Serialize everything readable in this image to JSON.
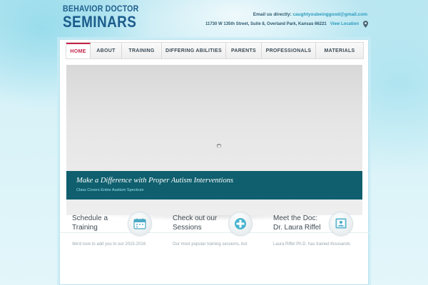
{
  "brand": {
    "line1": "BEHAVIOR DOCTOR",
    "line2": "SEMINARS"
  },
  "contact": {
    "email_label": "Email us directly:",
    "email": "caughtyoubeinggood@gmail.com",
    "address": "11730 W 135th Street, Suite 8, Overland Park, Kansas 66221",
    "view_location": "View Location"
  },
  "nav": {
    "items": [
      {
        "label": "HOME",
        "active": true
      },
      {
        "label": "ABOUT",
        "active": false
      },
      {
        "label": "TRAINING",
        "active": false
      },
      {
        "label": "DIFFERING ABILITIES",
        "active": false
      },
      {
        "label": "PARENTS",
        "active": false
      },
      {
        "label": "PROFESSIONALS",
        "active": false
      },
      {
        "label": "MATERIALS",
        "active": false
      }
    ]
  },
  "slider": {
    "title": "Make a Difference with Proper Autism Interventions",
    "subtitle": "Class Covers Entire Austism Spectrum"
  },
  "features": [
    {
      "title_line1": "Schedule a",
      "title_line2": "Training",
      "text": "We'd love to add you to our 2015-2016",
      "icon": "calendar-icon"
    },
    {
      "title_line1": "Check out our",
      "title_line2": "Sessions",
      "text": "Our most popular training sessions, but",
      "icon": "medical-cross-icon"
    },
    {
      "title_line1": "Meet the Doc:",
      "title_line2": "Dr. Laura Riffel",
      "text": "Laura Riffel Ph.D. has trained thousands",
      "icon": "profile-book-icon"
    }
  ],
  "colors": {
    "accent": "#c4254a",
    "caption_bg": "#0f5f6e",
    "link": "#2a9bbd",
    "logo": "#1c5c8c"
  }
}
